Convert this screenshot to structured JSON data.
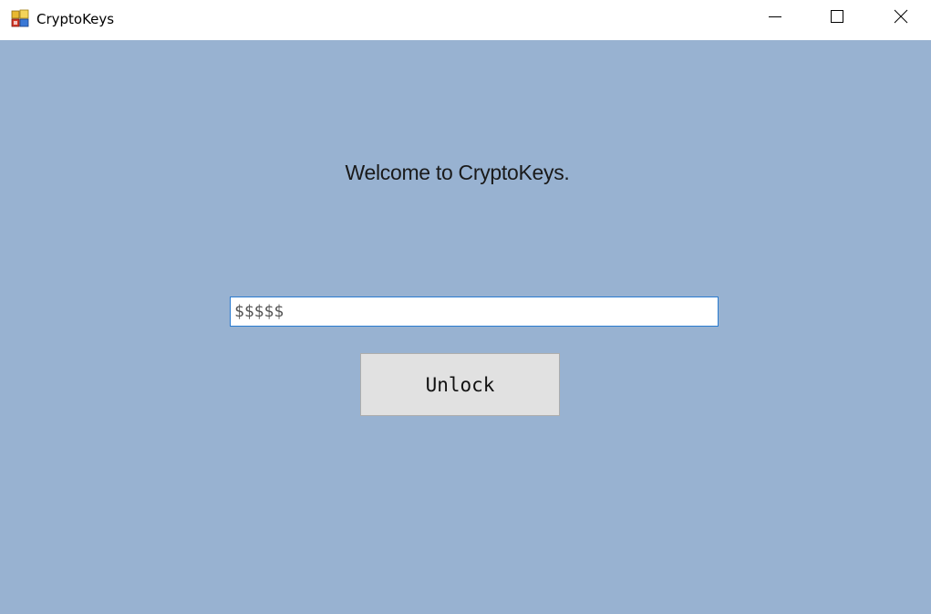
{
  "window": {
    "title": "CryptoKeys",
    "app_icon": "app-icon",
    "controls": {
      "minimize_icon": "minimize-icon",
      "maximize_icon": "maximize-icon",
      "close_icon": "close-icon"
    }
  },
  "main": {
    "welcome_text": "Welcome to CryptoKeys.",
    "password_field": {
      "value": "$$$$$",
      "placeholder": ""
    },
    "unlock_button_label": "Unlock"
  },
  "colors": {
    "client_background": "#98b2d1",
    "button_background": "#e1e1e1",
    "input_focus_border": "#2a7bd0"
  }
}
